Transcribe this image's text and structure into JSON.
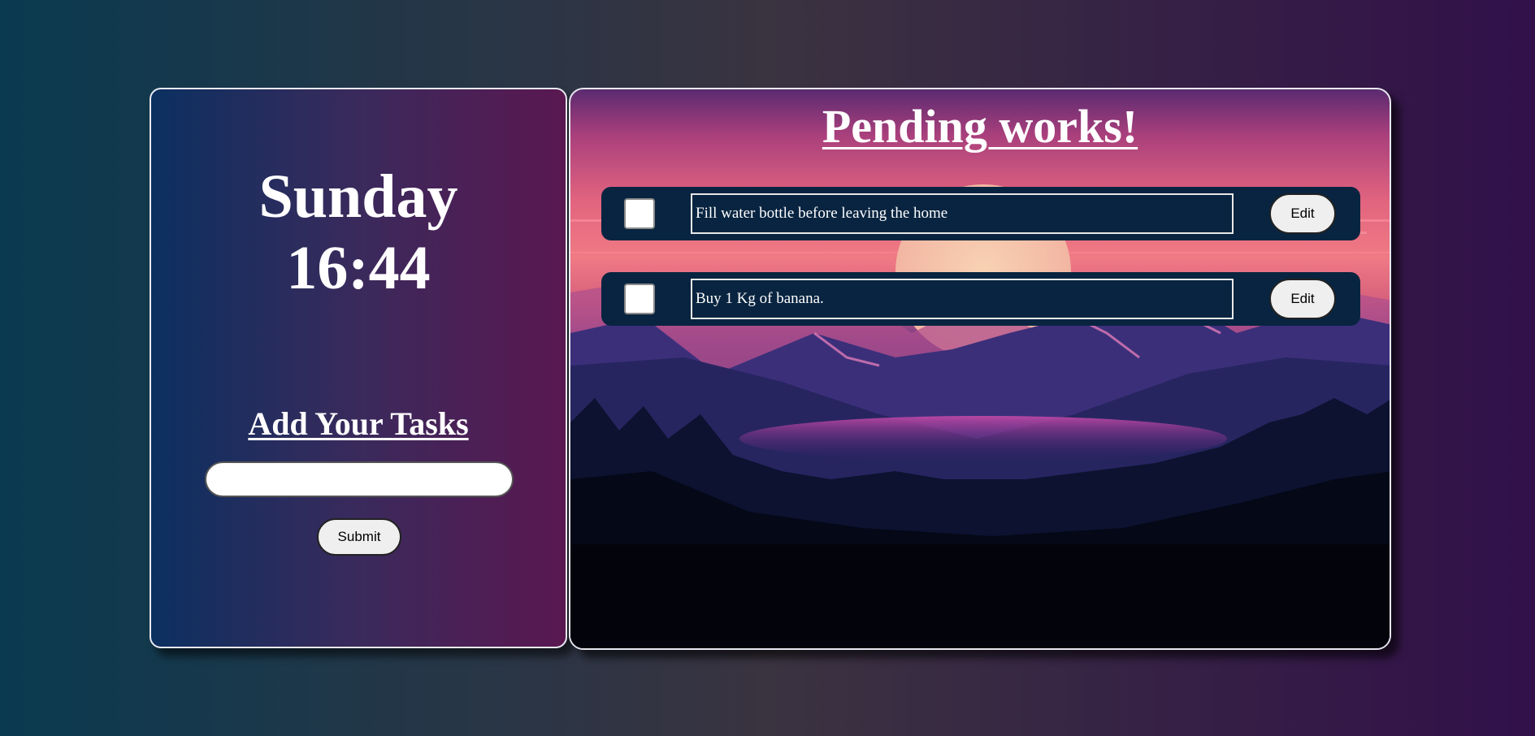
{
  "clock": {
    "day": "Sunday",
    "time": "16:44"
  },
  "add_panel": {
    "title": "Add Your Tasks",
    "input_value": "",
    "submit_label": "Submit"
  },
  "pending_panel": {
    "title": "Pending works!",
    "tasks": [
      {
        "text": "Fill water bottle before leaving the home",
        "checked": false,
        "edit_label": "Edit"
      },
      {
        "text": "Buy 1 Kg of banana.",
        "checked": false,
        "edit_label": "Edit"
      }
    ]
  },
  "colors": {
    "task_row_bg": "#082440",
    "page_gradient_start": "#0a3a50",
    "page_gradient_end": "#32104a"
  }
}
